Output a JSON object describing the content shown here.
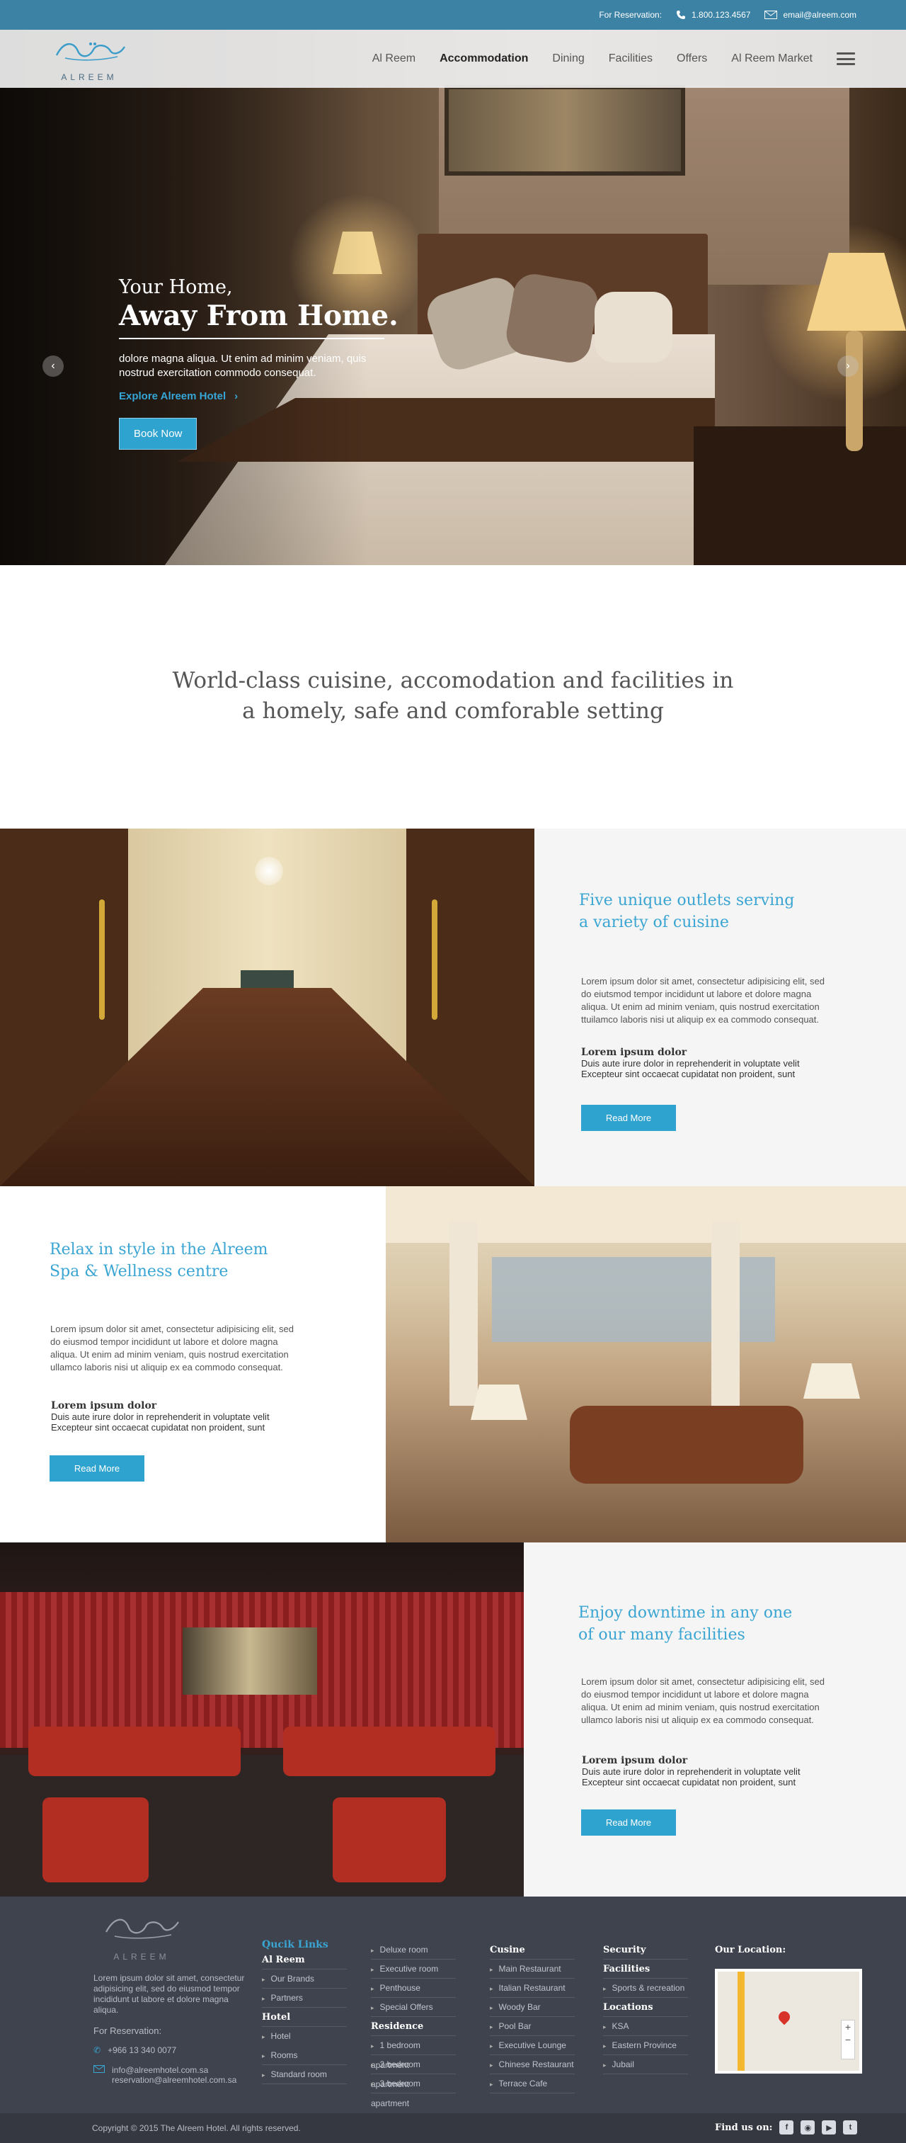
{
  "topbar": {
    "reservation_label": "For Reservation:",
    "phone": "1.800.123.4567",
    "email": "email@alreem.com"
  },
  "brand": {
    "name": "ALREEM"
  },
  "nav": {
    "items": [
      "Al Reem",
      "Accommodation",
      "Dining",
      "Facilities",
      "Offers",
      "Al Reem Market"
    ],
    "active": "Accommodation"
  },
  "hero": {
    "line1": "Your Home,",
    "line2": "Away From Home.",
    "description": "dolore magna aliqua. Ut enim ad minim veniam, quis nostrud exercitation  commodo consequat.",
    "explore_label": "Explore Alreem Hotel",
    "book_label": "Book Now"
  },
  "intro": {
    "heading": "World-class cuisine, accomodation and facilities in a homely, safe and comforable setting"
  },
  "features": [
    {
      "heading_1": "Five unique outlets serving",
      "heading_2": "a variety of cuisine",
      "body": "Lorem ipsum dolor sit amet, consectetur adipisicing elit, sed do eiutsmod tempor incididunt ut labore et dolore magna aliqua. Ut enim ad minim veniam, quis nostrud exercitation ttuilamco laboris nisi ut aliquip ex ea commodo consequat.",
      "sub_title": "Lorem ipsum dolor",
      "sub_body": "Duis aute irure dolor in reprehenderit in voluptate velit Excepteur sint occaecat cupidatat non proident, sunt",
      "button": "Read More"
    },
    {
      "heading_1": "Relax in style in the Alreem",
      "heading_2": "Spa & Wellness centre",
      "body": "Lorem ipsum dolor sit amet, consectetur adipisicing elit, sed do eiusmod tempor incididunt ut labore et dolore magna aliqua. Ut enim ad minim veniam, quis nostrud exercitation ullamco laboris nisi ut aliquip ex ea commodo consequat.",
      "sub_title": "Lorem ipsum dolor",
      "sub_body": "Duis aute irure dolor in reprehenderit in voluptate velit Excepteur sint occaecat cupidatat non proident, sunt",
      "button": "Read More"
    },
    {
      "heading_1": "Enjoy downtime in any one",
      "heading_2": "of our many facilities",
      "body": "Lorem ipsum dolor sit amet, consectetur adipisicing elit, sed do eiusmod tempor incididunt ut labore et dolore magna aliqua. Ut enim ad minim veniam, quis nostrud exercitation ullamco laboris nisi ut aliquip ex ea commodo consequat.",
      "sub_title": "Lorem ipsum dolor",
      "sub_body": "Duis aute irure dolor in reprehenderit in voluptate velit Excepteur sint occaecat cupidatat non proident, sunt",
      "button": "Read More"
    }
  ],
  "footer": {
    "brand": "ALREEM",
    "about": "Lorem ipsum dolor sit amet, consectetur adipisicing elit, sed do eiusmod tempor incididunt ut labore et dolore magna aliqua.",
    "reservation_label": "For Reservation:",
    "phone": "+966 13 340 0077",
    "email_1": "info@alreemhotel.com.sa",
    "email_2": "reservation@alreemhotel.com.sa",
    "quick_links_title": "Qucik Links",
    "alreem_title": "Al Reem",
    "alreem_items": [
      "Our Brands",
      "Partners"
    ],
    "hotel_title": "Hotel",
    "hotel_items": [
      "Rooms",
      "Standard room"
    ],
    "rooms_items": [
      "Deluxe room",
      "Executive room",
      "Penthouse",
      "Special Offers"
    ],
    "residence_title": "Residence",
    "residence_items": [
      "1 bedroom apartment",
      "2 bedroom apartment",
      "3 bedroom apartment"
    ],
    "cusine_title": "Cusine",
    "cusine_items": [
      "Main Restaurant",
      "Italian Restaurant",
      "Woody Bar",
      "Pool Bar",
      "Executive Lounge",
      "Chinese Restaurant",
      "Terrace Cafe"
    ],
    "security_title": "Security",
    "facilities_title": "Facilities",
    "facilities_items": [
      "Sports & recreation"
    ],
    "locations_title": "Locations",
    "locations_items": [
      "KSA",
      "Eastern Province",
      "Jubail"
    ],
    "location_title": "Our Location:",
    "copyright": "Copyright © 2015 The Alreem Hotel. All rights reserved.",
    "find_us": "Find us on:"
  },
  "icons": {
    "phone": "phone-icon",
    "email": "envelope-icon",
    "menu": "hamburger-icon",
    "prev": "chevron-left-icon",
    "next": "chevron-right-icon",
    "social": [
      "facebook-icon",
      "instagram-icon",
      "youtube-icon",
      "twitter-icon"
    ]
  },
  "colors": {
    "accent": "#2fa3cf",
    "topbar": "#3b82a5",
    "footer": "#3f434d"
  }
}
